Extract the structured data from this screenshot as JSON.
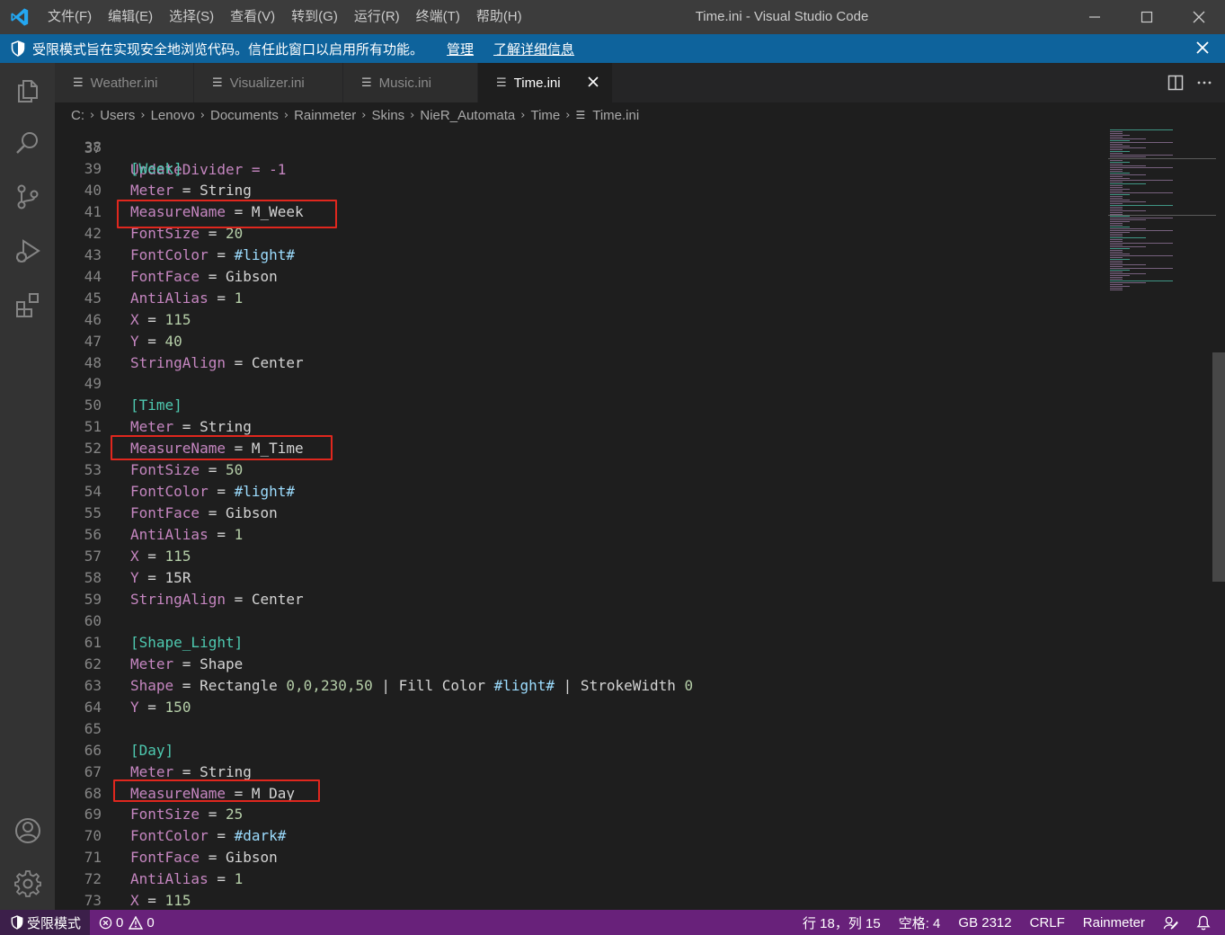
{
  "window": {
    "title": "Time.ini - Visual Studio Code"
  },
  "menu": [
    {
      "label": "文件(F)"
    },
    {
      "label": "编辑(E)"
    },
    {
      "label": "选择(S)"
    },
    {
      "label": "查看(V)"
    },
    {
      "label": "转到(G)"
    },
    {
      "label": "运行(R)"
    },
    {
      "label": "终端(T)"
    },
    {
      "label": "帮助(H)"
    }
  ],
  "banner": {
    "message": "受限模式旨在实现安全地浏览代码。信任此窗口以启用所有功能。",
    "manage": "管理",
    "learn_more": "了解详细信息"
  },
  "tabs": [
    {
      "label": "Weather.ini",
      "active": false
    },
    {
      "label": "Visualizer.ini",
      "active": false
    },
    {
      "label": "Music.ini",
      "active": false
    },
    {
      "label": "Time.ini",
      "active": true
    }
  ],
  "breadcrumb": [
    "C:",
    "Users",
    "Lenovo",
    "Documents",
    "Rainmeter",
    "Skins",
    "NieR_Automata",
    "Time",
    "Time.ini"
  ],
  "editor": {
    "partial_top": "UpdateDivider = -1",
    "lines": [
      {
        "n": "38",
        "t": ""
      },
      {
        "n": "39",
        "t": "[Week]"
      },
      {
        "n": "40",
        "t": "Meter = String"
      },
      {
        "n": "41",
        "t": "MeasureName = M_Week"
      },
      {
        "n": "42",
        "t": "FontSize = 20"
      },
      {
        "n": "43",
        "t": "FontColor = #light#"
      },
      {
        "n": "44",
        "t": "FontFace = Gibson"
      },
      {
        "n": "45",
        "t": "AntiAlias = 1"
      },
      {
        "n": "46",
        "t": "X = 115"
      },
      {
        "n": "47",
        "t": "Y = 40"
      },
      {
        "n": "48",
        "t": "StringAlign = Center"
      },
      {
        "n": "49",
        "t": ""
      },
      {
        "n": "50",
        "t": "[Time]"
      },
      {
        "n": "51",
        "t": "Meter = String"
      },
      {
        "n": "52",
        "t": "MeasureName = M_Time"
      },
      {
        "n": "53",
        "t": "FontSize = 50"
      },
      {
        "n": "54",
        "t": "FontColor = #light#"
      },
      {
        "n": "55",
        "t": "FontFace = Gibson"
      },
      {
        "n": "56",
        "t": "AntiAlias = 1"
      },
      {
        "n": "57",
        "t": "X = 115"
      },
      {
        "n": "58",
        "t": "Y = 15R"
      },
      {
        "n": "59",
        "t": "StringAlign = Center"
      },
      {
        "n": "60",
        "t": ""
      },
      {
        "n": "61",
        "t": "[Shape_Light]"
      },
      {
        "n": "62",
        "t": "Meter = Shape"
      },
      {
        "n": "63",
        "t": "Shape = Rectangle 0,0,230,50 | Fill Color #light# | StrokeWidth 0"
      },
      {
        "n": "64",
        "t": "Y = 150"
      },
      {
        "n": "65",
        "t": ""
      },
      {
        "n": "66",
        "t": "[Day]"
      },
      {
        "n": "67",
        "t": "Meter = String"
      },
      {
        "n": "68",
        "t": "MeasureName = M_Day"
      },
      {
        "n": "69",
        "t": "FontSize = 25"
      },
      {
        "n": "70",
        "t": "FontColor = #dark#"
      },
      {
        "n": "71",
        "t": "FontFace = Gibson"
      },
      {
        "n": "72",
        "t": "AntiAlias = 1"
      },
      {
        "n": "73",
        "t": "X = 115"
      }
    ],
    "annotation_color": "#e0271e"
  },
  "statusbar": {
    "restricted": "受限模式",
    "errors": "0",
    "warnings": "0",
    "position": "行 18，列 15",
    "spaces": "空格: 4",
    "encoding": "GB 2312",
    "eol": "CRLF",
    "language": "Rainmeter"
  },
  "colors": {
    "titlebar": "#3c3c3c",
    "banner": "#0e639c",
    "activitybar": "#333333",
    "statusbar": "#68217a",
    "editor_bg": "#1e1e1e"
  }
}
